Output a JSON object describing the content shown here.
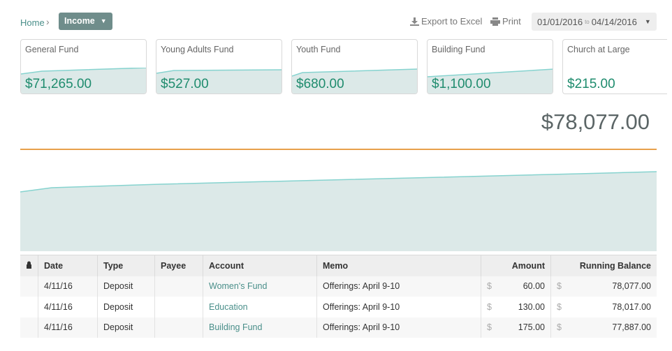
{
  "breadcrumb": {
    "home": "Home",
    "current": "Income"
  },
  "toolbar": {
    "export_label": "Export to Excel",
    "print_label": "Print"
  },
  "date_range": {
    "from": "01/01/2016",
    "to_word": "to",
    "to": "04/14/2016"
  },
  "funds": [
    {
      "name": "General Fund",
      "amount": "$71,265.00"
    },
    {
      "name": "Young Adults Fund",
      "amount": "$527.00"
    },
    {
      "name": "Youth Fund",
      "amount": "$680.00"
    },
    {
      "name": "Building Fund",
      "amount": "$1,100.00"
    },
    {
      "name": "Church at Large",
      "amount": "$215.00"
    }
  ],
  "total": "$78,077.00",
  "table": {
    "headers": {
      "lock": "🔒",
      "date": "Date",
      "type": "Type",
      "payee": "Payee",
      "account": "Account",
      "memo": "Memo",
      "amount": "Amount",
      "balance": "Running Balance"
    },
    "currency_symbol": "$",
    "rows": [
      {
        "date": "4/11/16",
        "type": "Deposit",
        "payee": "",
        "account": "Women's Fund",
        "memo": "Offerings: April 9-10",
        "amount": "60.00",
        "balance": "78,077.00"
      },
      {
        "date": "4/11/16",
        "type": "Deposit",
        "payee": "",
        "account": "Education",
        "memo": "Offerings: April 9-10",
        "amount": "130.00",
        "balance": "78,017.00"
      },
      {
        "date": "4/11/16",
        "type": "Deposit",
        "payee": "",
        "account": "Building Fund",
        "memo": "Offerings: April 9-10",
        "amount": "175.00",
        "balance": "77,887.00"
      }
    ]
  },
  "colors": {
    "accent": "#4a8f8a",
    "amount_green": "#1f8c6e",
    "chart_fill": "#dce9e8",
    "chart_line": "#86d3cf",
    "divider_orange": "#e8a04a"
  },
  "icons": {
    "export": "download-icon",
    "print": "printer-icon",
    "lock": "lock-icon"
  }
}
